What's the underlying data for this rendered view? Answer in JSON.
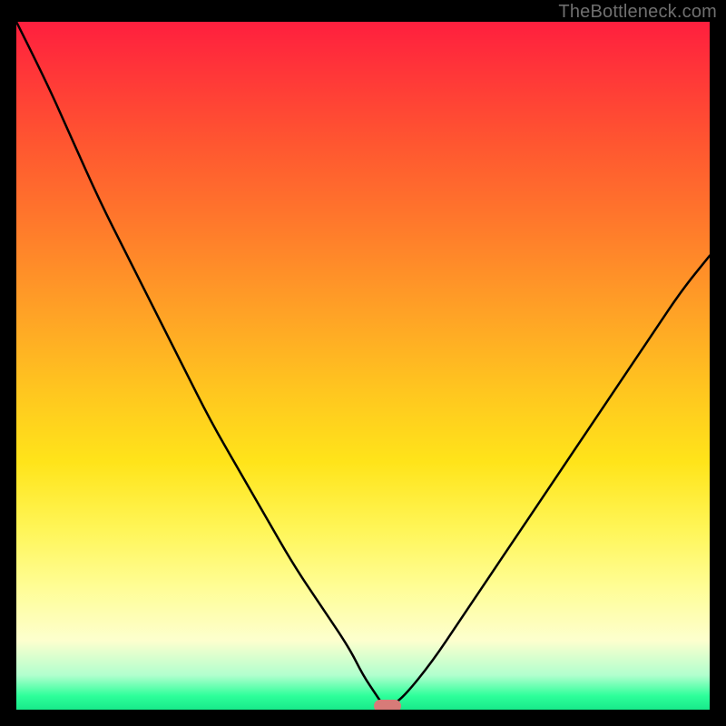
{
  "watermark": "TheBottleneck.com",
  "colors": {
    "curve_stroke": "#000000",
    "marker_fill": "#d77b78",
    "frame": "#000000"
  },
  "chart_data": {
    "type": "line",
    "title": "",
    "xlabel": "",
    "ylabel": "",
    "xlim": [
      0,
      100
    ],
    "ylim": [
      0,
      100
    ],
    "x": [
      0,
      4,
      8,
      12,
      16,
      20,
      24,
      28,
      32,
      36,
      40,
      44,
      48,
      50,
      52,
      53,
      54,
      56,
      60,
      64,
      68,
      72,
      76,
      80,
      84,
      88,
      92,
      96,
      100
    ],
    "y": [
      100,
      92,
      83,
      74,
      66,
      58,
      50,
      42,
      35,
      28,
      21,
      15,
      9,
      5,
      2,
      0.5,
      0.5,
      2,
      7,
      13,
      19,
      25,
      31,
      37,
      43,
      49,
      55,
      61,
      66
    ],
    "marker": {
      "x": 53.5,
      "y": 0.5
    },
    "background_gradient": "red-to-green vertical"
  }
}
